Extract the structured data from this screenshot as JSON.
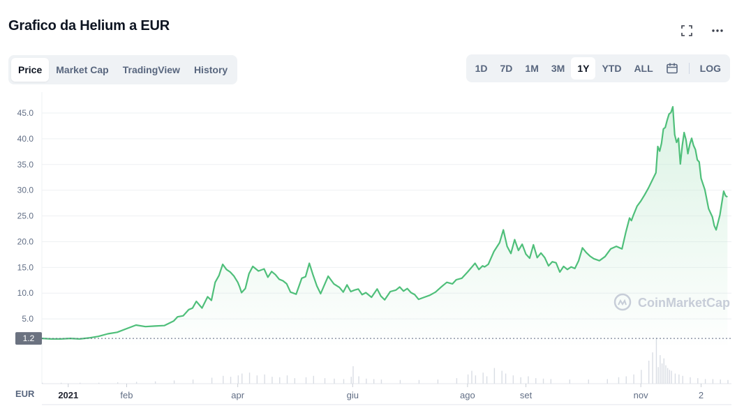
{
  "header": {
    "title": "Grafico da Helium a EUR"
  },
  "tabs": [
    {
      "label": "Price",
      "active": true
    },
    {
      "label": "Market Cap",
      "active": false
    },
    {
      "label": "TradingView",
      "active": false
    },
    {
      "label": "History",
      "active": false
    }
  ],
  "ranges": [
    {
      "label": "1D",
      "active": false
    },
    {
      "label": "7D",
      "active": false
    },
    {
      "label": "1M",
      "active": false
    },
    {
      "label": "3M",
      "active": false
    },
    {
      "label": "1Y",
      "active": true
    },
    {
      "label": "YTD",
      "active": false
    },
    {
      "label": "ALL",
      "active": false
    }
  ],
  "log_label": "LOG",
  "watermark": "CoinMarketCap",
  "currency_label": "EUR",
  "current_price_label": "1.2",
  "colors": {
    "line": "#4fbf7a",
    "area_top": "#bfe9cf",
    "volume": "#d9dde4",
    "current_price_bg": "#6b7280"
  },
  "chart_data": {
    "type": "area",
    "y_ticks": [
      "45.0",
      "40.0",
      "35.0",
      "30.0",
      "25.0",
      "20.0",
      "15.0",
      "10.0",
      "5.0"
    ],
    "ylim": [
      0,
      48
    ],
    "x_tick_labels": [
      {
        "label": "2021",
        "bold": true,
        "x": 14
      },
      {
        "label": "feb",
        "bold": false,
        "x": 45
      },
      {
        "label": "apr",
        "bold": false,
        "x": 104
      },
      {
        "label": "giu",
        "bold": false,
        "x": 165
      },
      {
        "label": "ago",
        "bold": false,
        "x": 226
      },
      {
        "label": "set",
        "bold": false,
        "x": 257
      },
      {
        "label": "nov",
        "bold": false,
        "x": 318
      },
      {
        "label": "2",
        "bold": false,
        "x": 350
      }
    ],
    "xlim": [
      0,
      365
    ],
    "series": [
      {
        "x": [
          0,
          5,
          10,
          15,
          20,
          25,
          30,
          35,
          40,
          45,
          50,
          55,
          60,
          65,
          70,
          72,
          75,
          78,
          80,
          82,
          85,
          88,
          90,
          92,
          94,
          96,
          98,
          100,
          102,
          104,
          105,
          106,
          108,
          110,
          112,
          115,
          118,
          120,
          122,
          124,
          126,
          128,
          130,
          132,
          135,
          138,
          140,
          142,
          144,
          146,
          148,
          150,
          152,
          155,
          158,
          160,
          162,
          164,
          166,
          168,
          170,
          172,
          175,
          178,
          180,
          182,
          185,
          188,
          190,
          192,
          194,
          196,
          198,
          200,
          203,
          206,
          209,
          212,
          215,
          218,
          220,
          223,
          226,
          230,
          232,
          234,
          235,
          237,
          240,
          243,
          245,
          247,
          249,
          251,
          253,
          255,
          257,
          259,
          261,
          263,
          265,
          267,
          269,
          271,
          273,
          275,
          277,
          279,
          281,
          283,
          285,
          287,
          289,
          291,
          293,
          296,
          299,
          302,
          305,
          308,
          310,
          312,
          313,
          314,
          316,
          318,
          320,
          322,
          324,
          326,
          327,
          328,
          329,
          330,
          331,
          332,
          333,
          334,
          335,
          336,
          337,
          338,
          339,
          340,
          341,
          342,
          343,
          344,
          345,
          346,
          347,
          348,
          349,
          350,
          352,
          354,
          356,
          357,
          358,
          360,
          362,
          363,
          364
        ],
        "y": [
          1.2,
          1.1,
          1.1,
          1.2,
          1.1,
          1.3,
          1.6,
          2.1,
          2.4,
          3.1,
          3.8,
          3.5,
          3.6,
          3.7,
          4.6,
          5.4,
          5.6,
          6.8,
          7.1,
          8.4,
          7.1,
          9.3,
          8.6,
          12.1,
          13.4,
          15.6,
          14.6,
          14.1,
          13.3,
          12.1,
          11.2,
          10.1,
          10.9,
          13.8,
          15.2,
          14.3,
          14.7,
          13.1,
          14.2,
          13.6,
          12.7,
          12.4,
          11.8,
          10.2,
          9.8,
          12.9,
          13.2,
          15.8,
          13.5,
          11.4,
          9.9,
          11.6,
          13.3,
          11.8,
          11.1,
          10.2,
          11.6,
          10.3,
          10.6,
          10.8,
          9.7,
          10.1,
          9.2,
          10.8,
          9.4,
          8.7,
          10.3,
          10.6,
          11.2,
          10.4,
          10.9,
          10.1,
          9.7,
          8.8,
          9.2,
          9.6,
          10.2,
          11.2,
          12.1,
          11.8,
          12.6,
          12.9,
          14.1,
          15.8,
          14.6,
          15.3,
          15.1,
          15.6,
          18.1,
          19.8,
          22.3,
          19.1,
          17.7,
          20.4,
          18.3,
          19.5,
          17.6,
          16.8,
          19.4,
          16.9,
          17.8,
          16.9,
          15.3,
          16.1,
          15.9,
          14.1,
          15.2,
          14.6,
          15.1,
          14.8,
          16.3,
          18.8,
          17.9,
          17.2,
          16.7,
          16.3,
          17.1,
          18.6,
          19.1,
          18.6,
          21.8,
          24.6,
          24.1,
          25.1,
          26.9,
          27.9,
          29.1,
          30.4,
          31.9,
          33.4,
          38.5,
          37.6,
          39.1,
          41.9,
          42.2,
          43.6,
          44.8,
          45.1,
          46.2,
          40.8,
          39.3,
          40.1,
          35.1,
          38.6,
          41.2,
          39.8,
          37.1,
          38.9,
          40.1,
          38.7,
          37.9,
          35.9,
          35.5,
          32.3,
          30.1,
          26.4,
          24.8,
          23.1,
          22.3,
          25.2,
          29.8,
          28.9,
          28.7
        ]
      }
    ],
    "volume_x": [
      0,
      10,
      20,
      30,
      40,
      50,
      60,
      70,
      80,
      90,
      96,
      100,
      104,
      106,
      110,
      114,
      118,
      122,
      126,
      130,
      134,
      140,
      144,
      150,
      155,
      160,
      164,
      165,
      168,
      172,
      176,
      180,
      190,
      200,
      210,
      220,
      226,
      228,
      230,
      234,
      236,
      240,
      244,
      246,
      250,
      254,
      258,
      262,
      266,
      270,
      280,
      290,
      300,
      306,
      310,
      314,
      318,
      322,
      324,
      326,
      327,
      328,
      329,
      330,
      331,
      332,
      333,
      334,
      336,
      338,
      340,
      344,
      348,
      352,
      356,
      360,
      364
    ],
    "volume_y": [
      0.02,
      0.02,
      0.02,
      0.02,
      0.03,
      0.04,
      0.05,
      0.07,
      0.09,
      0.13,
      0.17,
      0.15,
      0.18,
      0.22,
      0.24,
      0.18,
      0.2,
      0.15,
      0.14,
      0.18,
      0.12,
      0.14,
      0.17,
      0.12,
      0.11,
      0.1,
      0.15,
      0.38,
      0.16,
      0.11,
      0.1,
      0.09,
      0.08,
      0.08,
      0.09,
      0.12,
      0.2,
      0.28,
      0.18,
      0.24,
      0.16,
      0.34,
      0.28,
      0.22,
      0.18,
      0.14,
      0.16,
      0.12,
      0.11,
      0.1,
      0.09,
      0.09,
      0.1,
      0.14,
      0.16,
      0.2,
      0.3,
      0.5,
      0.68,
      1.0,
      0.36,
      0.62,
      0.44,
      0.55,
      0.4,
      0.34,
      0.3,
      0.28,
      0.22,
      0.2,
      0.17,
      0.14,
      0.12,
      0.1,
      0.1,
      0.09,
      0.08
    ]
  }
}
